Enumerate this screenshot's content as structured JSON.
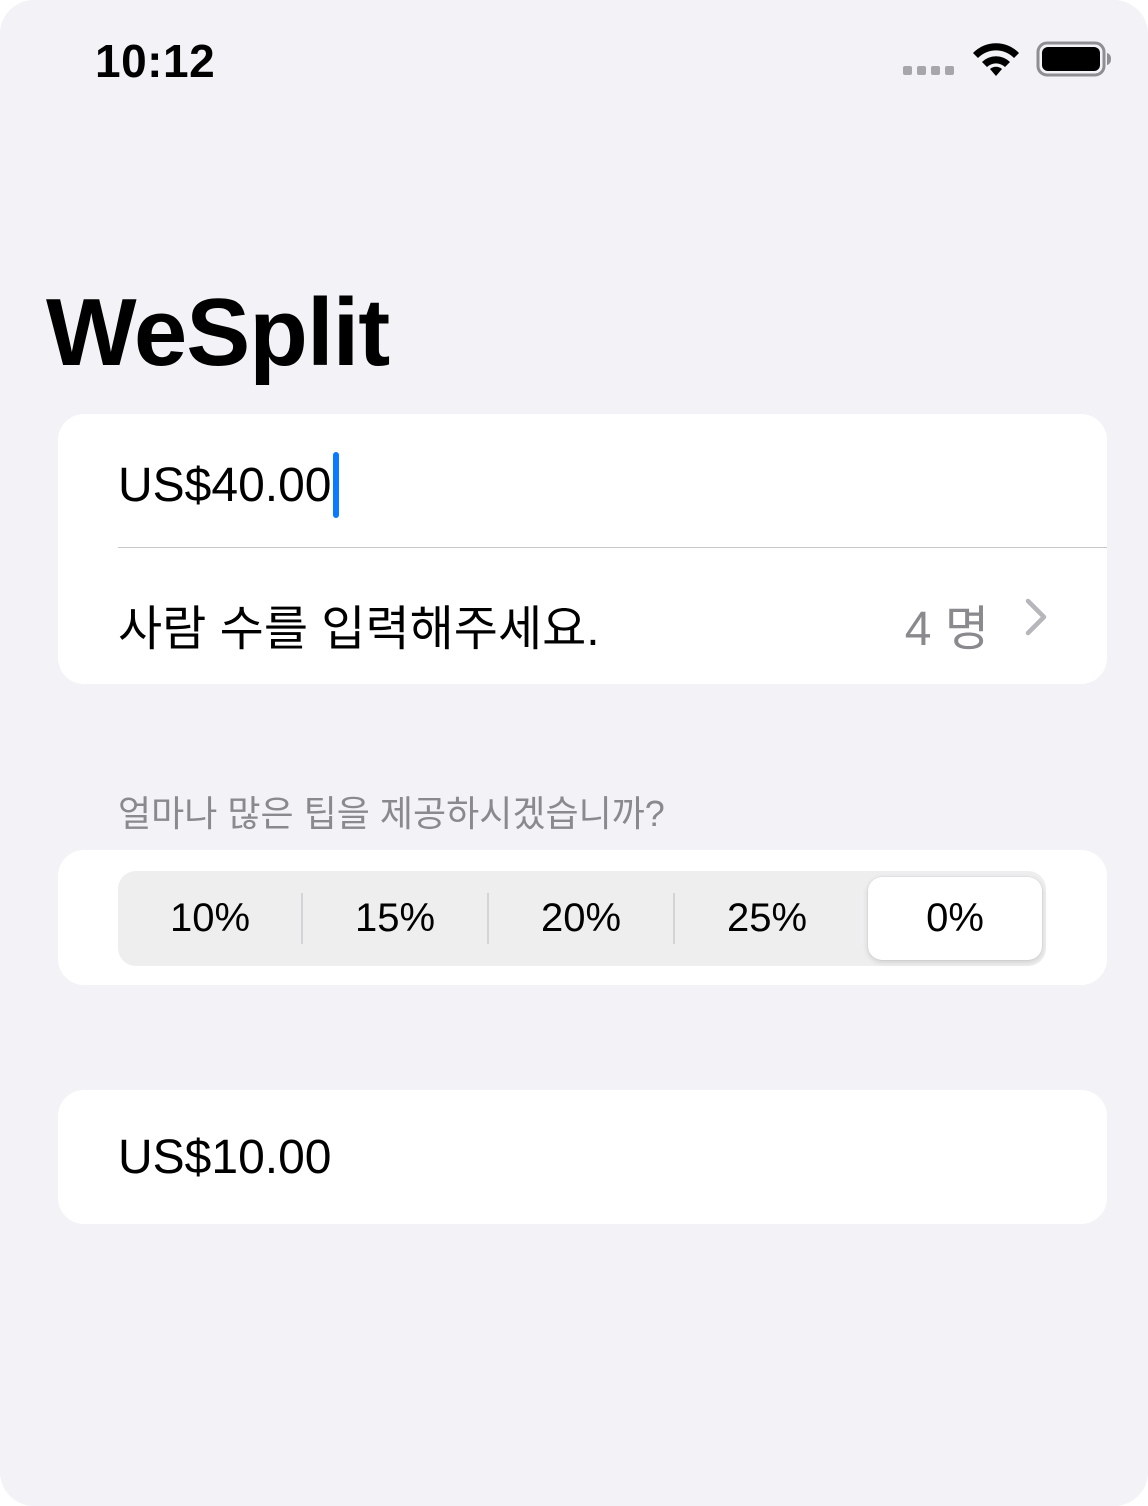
{
  "status_bar": {
    "time": "10:12",
    "icons": [
      "cellular-dots-icon",
      "wifi-icon",
      "battery-icon"
    ]
  },
  "title": "WeSplit",
  "input_section": {
    "check_amount": "US$40.00",
    "people_label": "사람 수를 입력해주세요.",
    "people_value": "4 명"
  },
  "tip_section": {
    "header": "얼마나 많은 팁을 제공하시겠습니까?",
    "options": [
      "10%",
      "15%",
      "20%",
      "25%",
      "0%"
    ],
    "selected": "0%"
  },
  "total_section": {
    "amount_per_person": "US$10.00"
  },
  "colors": {
    "background": "#f2f2f7",
    "card": "#ffffff",
    "cursor": "#0a7aff",
    "secondary_text": "#8a8a8e"
  }
}
